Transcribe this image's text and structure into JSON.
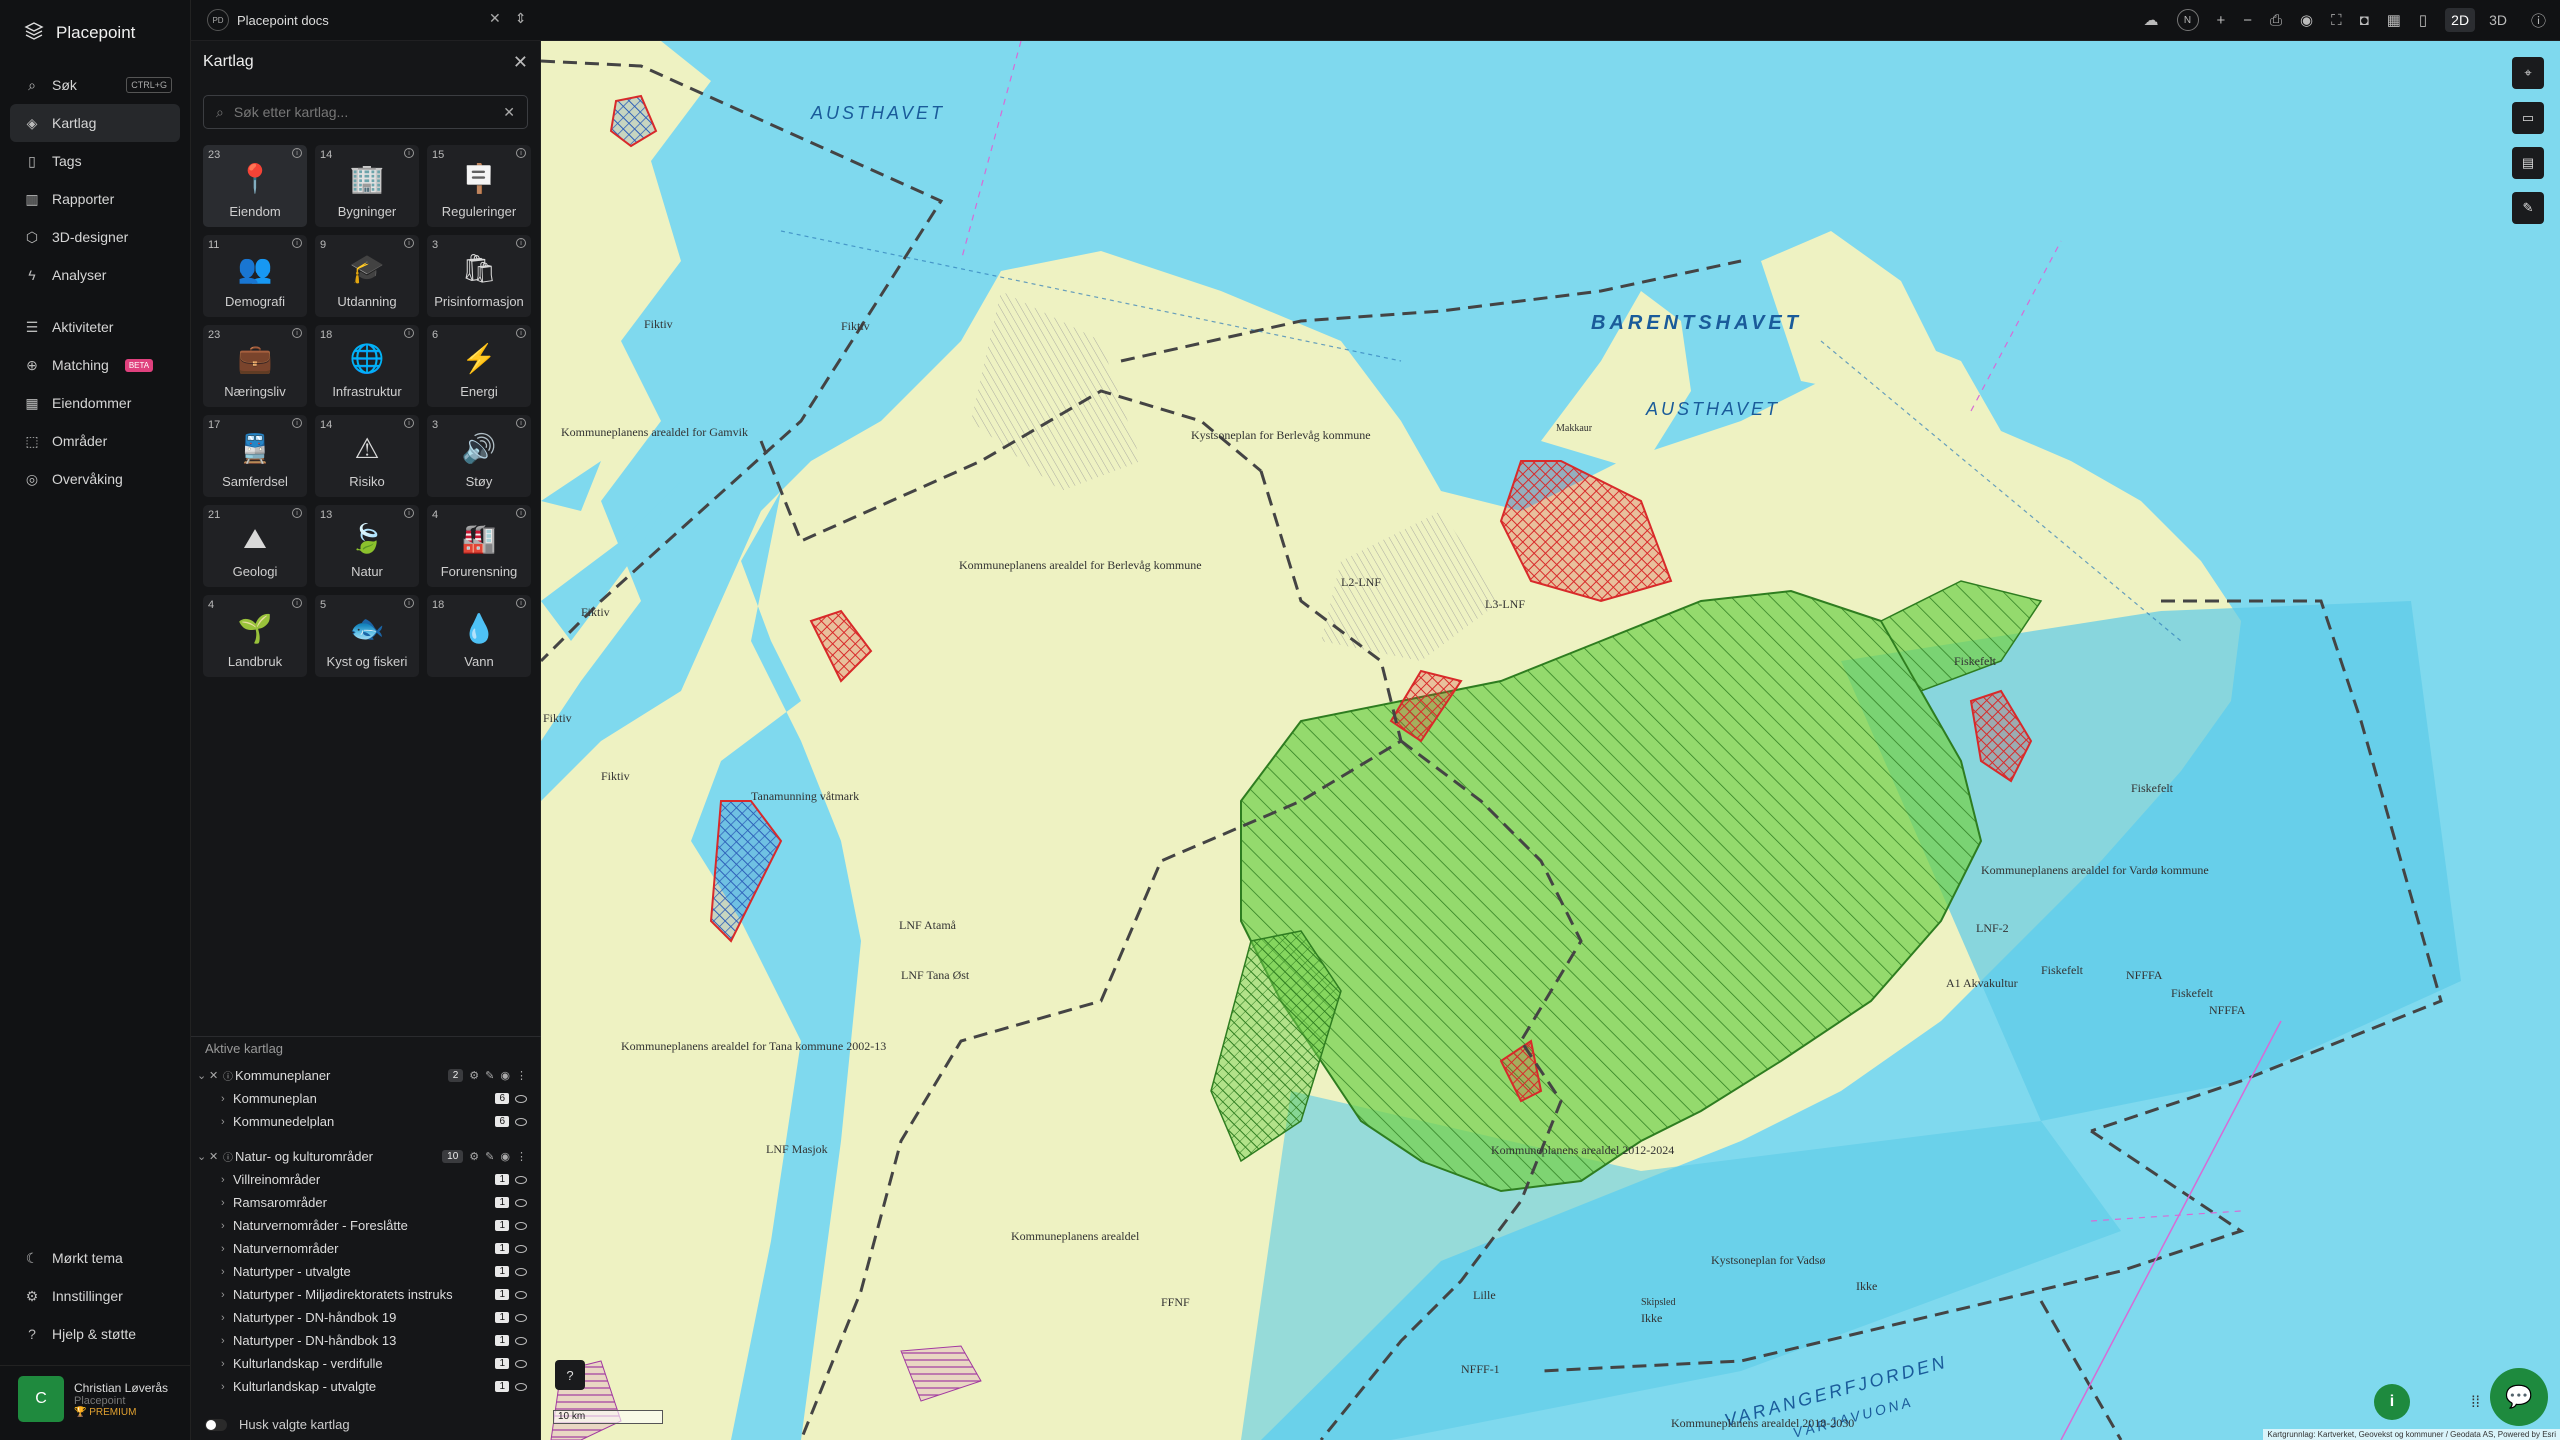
{
  "brand": "Placepoint",
  "nav": {
    "items": [
      {
        "label": "Søk",
        "shortcut": "CTRL+G"
      },
      {
        "label": "Kartlag"
      },
      {
        "label": "Tags"
      },
      {
        "label": "Rapporter"
      },
      {
        "label": "3D-designer"
      },
      {
        "label": "Analyser"
      },
      {
        "label": "Aktiviteter"
      },
      {
        "label": "Matching",
        "badge": "BETA"
      },
      {
        "label": "Eiendommer"
      },
      {
        "label": "Områder"
      },
      {
        "label": "Overvåking"
      }
    ],
    "bottom": [
      {
        "label": "Mørkt tema"
      },
      {
        "label": "Innstillinger"
      },
      {
        "label": "Hjelp & støtte"
      }
    ],
    "user": {
      "initial": "C",
      "name": "Christian Løverås",
      "org": "Placepoint",
      "plan": "PREMIUM"
    }
  },
  "topbar": {
    "doc_initials": "PD",
    "doc_title": "Placepoint docs",
    "compass": "N",
    "mode_2d": "2D",
    "mode_3d": "3D"
  },
  "panel": {
    "title": "Kartlag",
    "search_placeholder": "Søk etter kartlag...",
    "categories": [
      {
        "count": "23",
        "label": "Eiendom",
        "icon": "📍"
      },
      {
        "count": "14",
        "label": "Bygninger",
        "icon": "🏢"
      },
      {
        "count": "15",
        "label": "Reguleringer",
        "icon": "🪧"
      },
      {
        "count": "11",
        "label": "Demografi",
        "icon": "👥"
      },
      {
        "count": "9",
        "label": "Utdanning",
        "icon": "🎓"
      },
      {
        "count": "3",
        "label": "Prisinformasjon",
        "icon": "🛍"
      },
      {
        "count": "23",
        "label": "Næringsliv",
        "icon": "💼"
      },
      {
        "count": "18",
        "label": "Infrastruktur",
        "icon": "🌐"
      },
      {
        "count": "6",
        "label": "Energi",
        "icon": "⚡"
      },
      {
        "count": "17",
        "label": "Samferdsel",
        "icon": "🚆"
      },
      {
        "count": "14",
        "label": "Risiko",
        "icon": "⚠"
      },
      {
        "count": "3",
        "label": "Støy",
        "icon": "🔊"
      },
      {
        "count": "21",
        "label": "Geologi",
        "icon": "⛰"
      },
      {
        "count": "13",
        "label": "Natur",
        "icon": "🍃"
      },
      {
        "count": "4",
        "label": "Forurensning",
        "icon": "🏭"
      },
      {
        "count": "4",
        "label": "Landbruk",
        "icon": "🌱"
      },
      {
        "count": "5",
        "label": "Kyst og fiskeri",
        "icon": "🐟"
      },
      {
        "count": "18",
        "label": "Vann",
        "icon": "💧"
      }
    ],
    "active_title": "Aktive kartlag",
    "groups": [
      {
        "label": "Kommuneplaner",
        "count": "2",
        "layers": [
          {
            "label": "Kommuneplan",
            "count": "6"
          },
          {
            "label": "Kommunedelplan",
            "count": "6"
          }
        ]
      },
      {
        "label": "Natur- og kulturområder",
        "count": "10",
        "layers": [
          {
            "label": "Villreinområder",
            "count": "1"
          },
          {
            "label": "Ramsarområder",
            "count": "1"
          },
          {
            "label": "Naturvernområder - Foreslåtte",
            "count": "1"
          },
          {
            "label": "Naturvernområder",
            "count": "1"
          },
          {
            "label": "Naturtyper - utvalgte",
            "count": "1"
          },
          {
            "label": "Naturtyper - Miljødirektoratets instruks",
            "count": "1"
          },
          {
            "label": "Naturtyper - DN-håndbok 19",
            "count": "1"
          },
          {
            "label": "Naturtyper - DN-håndbok 13",
            "count": "1"
          },
          {
            "label": "Kulturlandskap - verdifulle",
            "count": "1"
          },
          {
            "label": "Kulturlandskap - utvalgte",
            "count": "1"
          }
        ]
      }
    ],
    "remember_label": "Husk valgte kartlag"
  },
  "map": {
    "labels": {
      "austhavet_1": "AUSTHAVET",
      "barentshavet": "BARENTSHAVET",
      "austhavet_2": "AUSTHAVET",
      "varangerfjorden": "VARANGERFJORDEN",
      "varjavuona": "VÁRJAVUONA",
      "kp_gamvik": "Kommuneplanens arealdel for Gamvik",
      "kp_berlevag": "Kommuneplanens arealdel for Berlevåg kommune",
      "kp_tana": "Kommuneplanens arealdel for Tana kommune 2002-13",
      "kp_vardo": "Kommuneplanens arealdel for Vardø kommune",
      "kp_2012": "Kommuneplanens arealdel 2012-2024",
      "kp_2018": "Kommuneplanens arealdel 2018-2030",
      "kp_arealdel": "Kommuneplanens arealdel",
      "ksp_berlevag": "Kystsoneplan for Berlevåg kommune",
      "ksp_vadso": "Kystsoneplan for Vadsø",
      "tanamunning": "Tanamunning våtmark",
      "fiktiv": "Fiktiv",
      "fiskefelt": "Fiskefelt",
      "nfffa": "NFFFA",
      "l3_lnf": "L3-LNF",
      "l2_lnf": "L2-LNF",
      "lnf_atama": "LNF Atamå",
      "lnf_tana_ost": "LNF Tana Øst",
      "lnf_masjok": "LNF Masjok",
      "akvakultur": "A1 Akvakultur",
      "lnf_2": "LNF-2",
      "ffnf": "FFNF",
      "nfff1": "NFFF-1",
      "makkaur": "Makkaur",
      "ikke": "Ikke",
      "lille": "Lille",
      "skipsled": "Skipsled"
    },
    "scale": "10 km",
    "attribution": "Kartgrunnlag: Kartverket, Geovekst og kommuner / Geodata AS, Powered by Esri",
    "colors": {
      "land": "#eef2c2",
      "sea": "#7fd9ee",
      "deep_sea": "#5ccbe8",
      "protected": "#7fd35a",
      "hatch_red": "#d82a2a",
      "hatch_blue": "#2d5fb8",
      "boundary": "#444444"
    }
  }
}
